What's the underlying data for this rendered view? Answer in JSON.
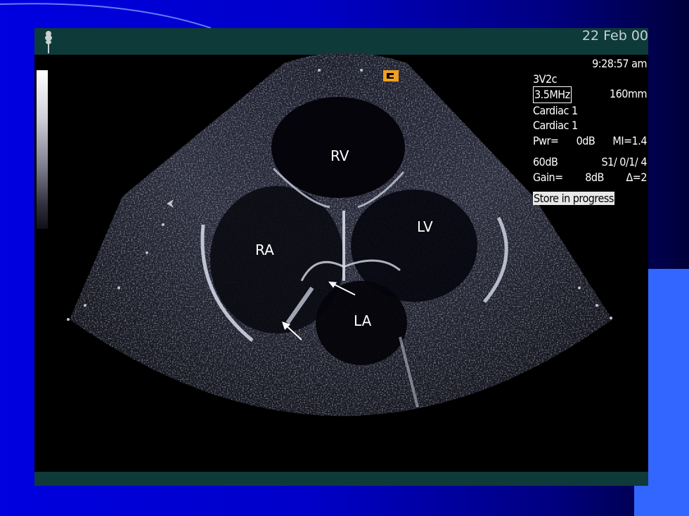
{
  "header": {
    "date": "22 Feb 00"
  },
  "info": {
    "time": "9:28:57 am",
    "probe": "3V2c",
    "frequency": "3.5MHz",
    "depth": "160mm",
    "preset_1": "Cardiac 1",
    "preset_2": "Cardiac 1",
    "power": "Pwr=",
    "power_value": "0dB",
    "mi": "MI=1.4",
    "dynamic_range": "60dB",
    "settings": "S1/ 0/1/ 4",
    "gain": "Gain=",
    "gain_value": "8dB",
    "delta": "Δ=2",
    "status": "Store in progress"
  },
  "labels": {
    "rv": "RV",
    "lv": "LV",
    "ra": "RA",
    "la": "LA"
  },
  "colors": {
    "background": "#0000c8",
    "accent_block": "#3366ff",
    "screen_bar": "#0e3a3a"
  }
}
